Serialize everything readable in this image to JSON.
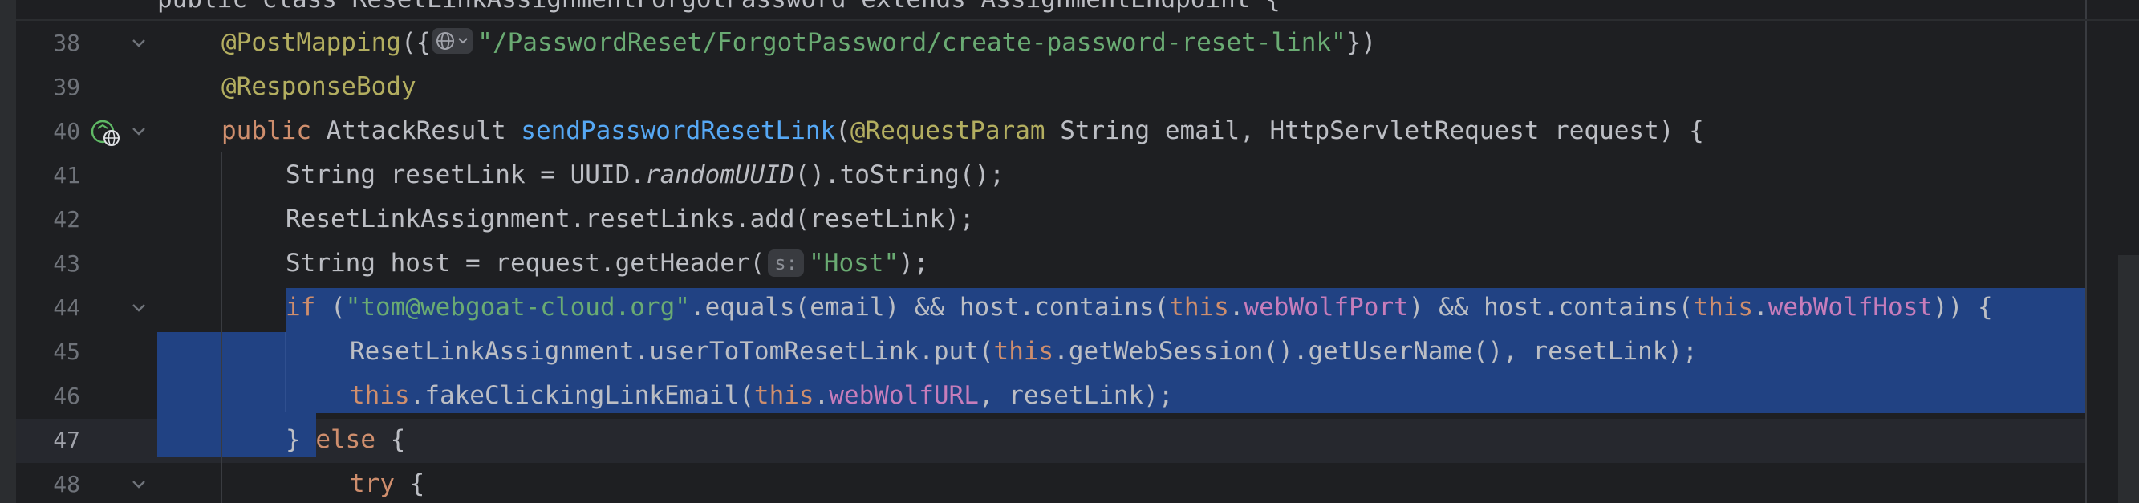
{
  "editor": {
    "top_line": {
      "visible": "public class ResetLinkAssignmentForgotPassword extends AssignmentEndpoint {"
    },
    "lines": [
      {
        "number": "38",
        "a1": "@PostMapping",
        "b1": "({",
        "c1": "\"/PasswordReset/ForgotPassword/create-password-reset-link\"",
        "d1": "})"
      },
      {
        "number": "39",
        "a1": "@ResponseBody"
      },
      {
        "number": "40",
        "a1": "public",
        "b1": " AttackResult ",
        "c1": "sendPasswordResetLink",
        "d1": "(",
        "e1": "@RequestParam",
        "f1": " String email, HttpServletRequest request) {"
      },
      {
        "number": "41",
        "a1": "String resetLink = UUID.",
        "b1": "randomUUID",
        "c1": "().toString();"
      },
      {
        "number": "42",
        "a1": "ResetLinkAssignment.resetLinks.add(resetLink);"
      },
      {
        "number": "43",
        "a1": "String host = request.getHeader(",
        "hint": "s:",
        "b1": "\"Host\"",
        "c1": ");"
      },
      {
        "number": "44",
        "a1": "if",
        "b1": " (",
        "c1": "\"tom@webgoat-cloud.org\"",
        "d1": ".equals(email) && host.contains(",
        "e1": "this",
        "f1": ".",
        "g1": "webWolfPort",
        "h1": ") && host.contains(",
        "i1": "this",
        "j1": ".",
        "k1": "webWolfHost",
        "l1": ")) {"
      },
      {
        "number": "45",
        "a1": "ResetLinkAssignment.userToTomResetLink.put(",
        "b1": "this",
        "c1": ".getWebSession().getUserName(), resetLink);"
      },
      {
        "number": "46",
        "a1": "this",
        "b1": ".fakeClickingLinkEmail(",
        "c1": "this",
        "d1": ".",
        "e1": "webWolfURL",
        "f1": ", resetLink);"
      },
      {
        "number": "47",
        "a1": "} ",
        "b1": "else",
        "c1": " {"
      },
      {
        "number": "48",
        "a1": "try",
        "b1": " {"
      }
    ]
  },
  "colors": {
    "background": "#1e1f22",
    "selection": "#214283",
    "keyword": "#cf8e6d",
    "annotation": "#b3ae60",
    "string": "#6aab73",
    "method": "#56a8f5",
    "field": "#c77dbb",
    "text": "#bcbec4",
    "line_number": "#6f737a"
  }
}
